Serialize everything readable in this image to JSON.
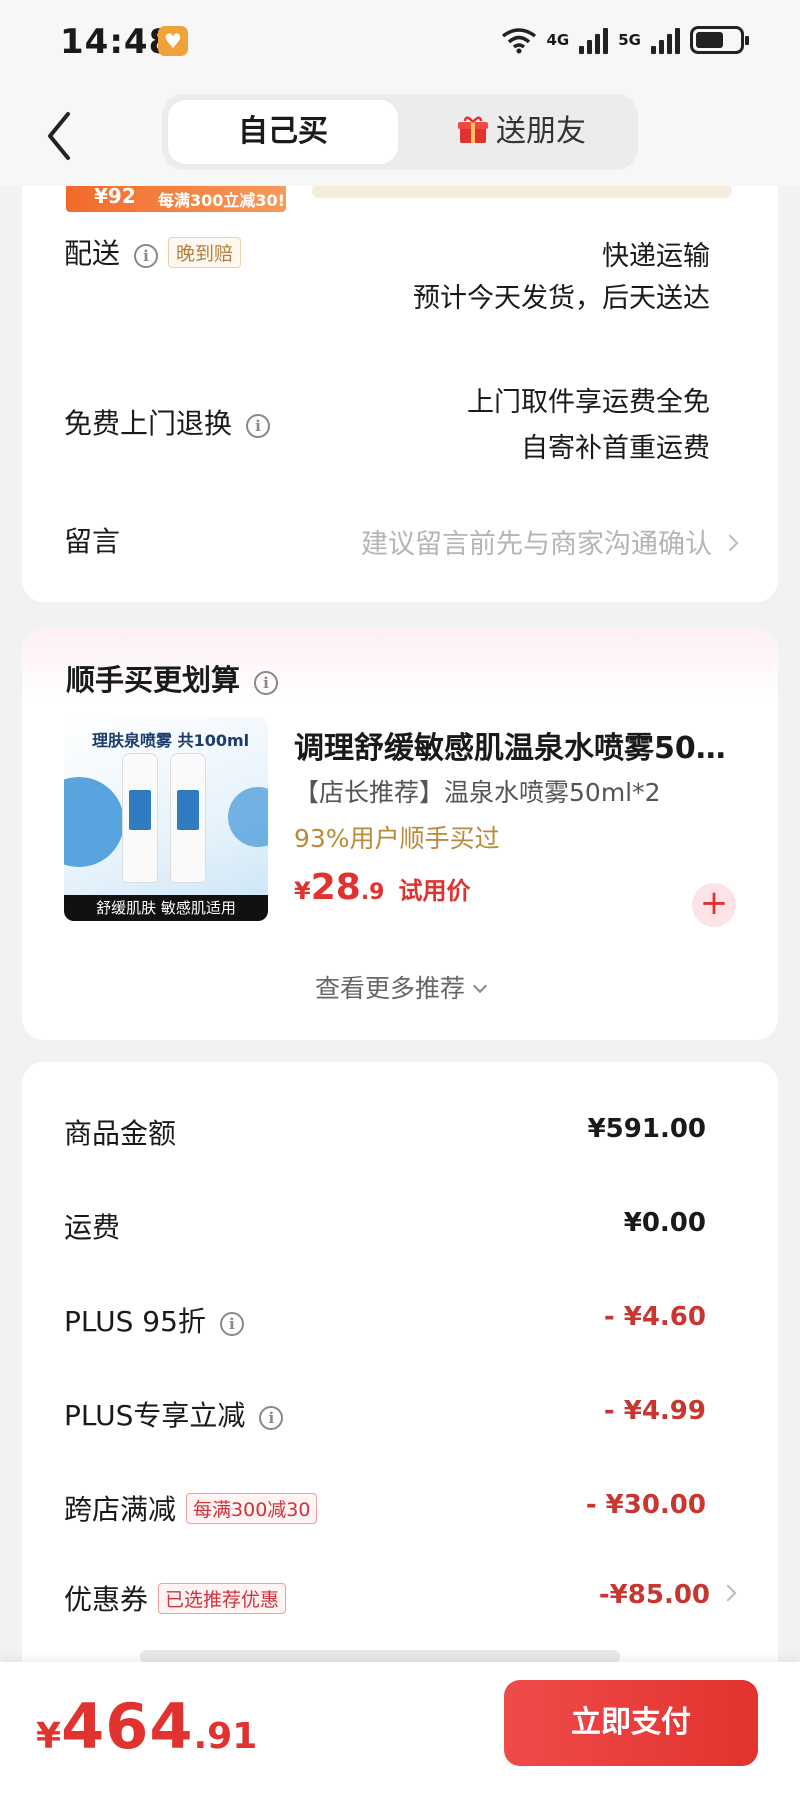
{
  "status_bar": {
    "time": "14:48",
    "signal_labels": [
      "4G",
      "5G"
    ],
    "battery_level": 0.65
  },
  "header": {
    "back_icon": "chevron-left-icon",
    "tabs": [
      {
        "label": "自己买",
        "active": true
      },
      {
        "label": "送朋友",
        "active": false,
        "icon": "gift-icon"
      }
    ]
  },
  "promo_banner": {
    "price_fragment": "¥92",
    "offer": "每满300立减30!"
  },
  "order_info": {
    "delivery": {
      "label": "配送",
      "tag": "晚到赔",
      "method": "快递运输",
      "estimate": "预计今天发货，后天送达"
    },
    "returns": {
      "label": "免费上门退换",
      "line1": "上门取件享运费全免",
      "line2": "自寄补首重运费"
    },
    "message": {
      "label": "留言",
      "placeholder": "建议留言前先与商家沟通确认"
    }
  },
  "recommendation": {
    "title": "顺手买更划算",
    "product": {
      "image_caption_top": "理肤泉喷雾 共100ml",
      "image_caption_bottom": "舒缓肌肤 敏感肌适用",
      "name": "调理舒缓敏感肌温泉水喷雾50ml*2",
      "subtitle": "【店长推荐】温泉水喷雾50ml*2",
      "stat": "93%用户顺手买过",
      "price_currency": "¥",
      "price_int": "28",
      "price_dec": ".9",
      "price_label": "试用价"
    },
    "more_label": "查看更多推荐"
  },
  "price_summary": {
    "rows": [
      {
        "label": "商品金额",
        "value": "¥591.00"
      },
      {
        "label": "运费",
        "value": "¥0.00"
      },
      {
        "label": "PLUS 95折",
        "value": "- ¥4.60"
      },
      {
        "label": "PLUS专享立减",
        "value": "- ¥4.99"
      },
      {
        "label": "跨店满减",
        "tag": "每满300减30",
        "value": "- ¥30.00"
      },
      {
        "label": "优惠券",
        "tag": "已选推荐优惠",
        "value": "-¥85.00"
      }
    ]
  },
  "footer": {
    "currency": "¥",
    "total_int": "464",
    "total_dec": ".91",
    "pay_label": "立即支付"
  },
  "colors": {
    "accent_red": "#e0322f",
    "discount_red": "#c8362f",
    "tag_gold": "#b08040",
    "background": "#f2f2f2"
  }
}
